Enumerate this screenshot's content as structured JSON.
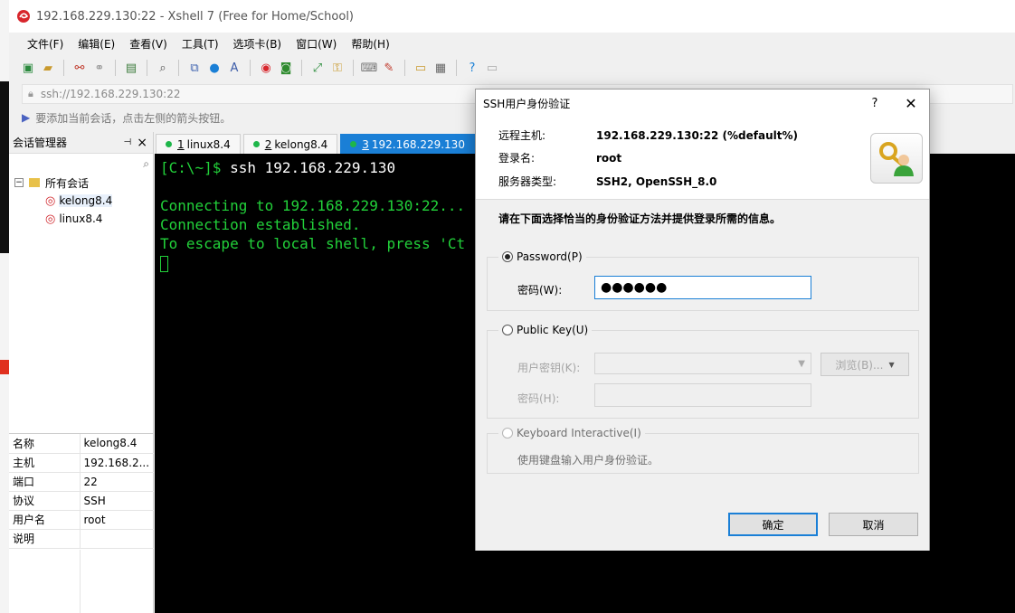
{
  "window": {
    "title": "192.168.229.130:22 - Xshell 7 (Free for Home/School)"
  },
  "menu": [
    "文件(F)",
    "编辑(E)",
    "查看(V)",
    "工具(T)",
    "选项卡(B)",
    "窗口(W)",
    "帮助(H)"
  ],
  "toolbar_icons": [
    "new-session-icon",
    "open-folder-icon",
    "disconnect-icon",
    "reconnect-icon",
    "properties-icon",
    "find-icon",
    "transfer-icon",
    "globe-icon",
    "font-icon",
    "xftp-icon",
    "xmanager-icon",
    "fullscreen-icon",
    "lock-icon",
    "keyboard-icon",
    "highlight-icon",
    "new-tab-icon",
    "layout-icon",
    "help-icon",
    "chat-icon"
  ],
  "address": {
    "value": "ssh://192.168.229.130:22"
  },
  "hint": {
    "text": "要添加当前会话，点击左侧的箭头按钮。"
  },
  "session_panel": {
    "title": "会话管理器",
    "root": "所有会话",
    "items": [
      "kelong8.4",
      "linux8.4"
    ],
    "selected": "kelong8.4"
  },
  "properties": [
    {
      "k": "名称",
      "v": "kelong8.4"
    },
    {
      "k": "主机",
      "v": "192.168.2..."
    },
    {
      "k": "端口",
      "v": "22"
    },
    {
      "k": "协议",
      "v": "SSH"
    },
    {
      "k": "用户名",
      "v": "root"
    },
    {
      "k": "说明",
      "v": ""
    }
  ],
  "tabs": [
    {
      "num": "1",
      "label": "linux8.4",
      "active": false
    },
    {
      "num": "2",
      "label": "kelong8.4",
      "active": false
    },
    {
      "num": "3",
      "label": "192.168.229.130",
      "active": true
    }
  ],
  "terminal": {
    "prompt": "[C:\\~]$ ",
    "command": "ssh 192.168.229.130",
    "lines": [
      "Connecting to 192.168.229.130:22...",
      "Connection established.",
      "To escape to local shell, press 'Ct"
    ]
  },
  "dialog": {
    "title": "SSH用户身份验证",
    "help": "?",
    "close": "✕",
    "remote_host_label": "远程主机:",
    "remote_host": "192.168.229.130:22 (%default%)",
    "login_label": "登录名:",
    "login": "root",
    "server_type_label": "服务器类型:",
    "server_type": "SSH2, OpenSSH_8.0",
    "instruction": "请在下面选择恰当的身份验证方法并提供登录所需的信息。",
    "password": {
      "label": "Password(P)",
      "field_label": "密码(W):",
      "value": "●●●●●●",
      "checked": true
    },
    "public_key": {
      "label": "Public Key(U)",
      "user_key_label": "用户密钥(K):",
      "browse": "浏览(B)...",
      "passphrase_label": "密码(H):",
      "checked": false
    },
    "keyboard": {
      "label": "Keyboard Interactive(I)",
      "desc": "使用键盘输入用户身份验证。"
    },
    "ok": "确定",
    "cancel": "取消"
  },
  "colors": {
    "accent": "#1a7fd6",
    "terminal_text": "#22d13a",
    "terminal_bg": "#000000",
    "status_dot": "#1eb64a"
  }
}
